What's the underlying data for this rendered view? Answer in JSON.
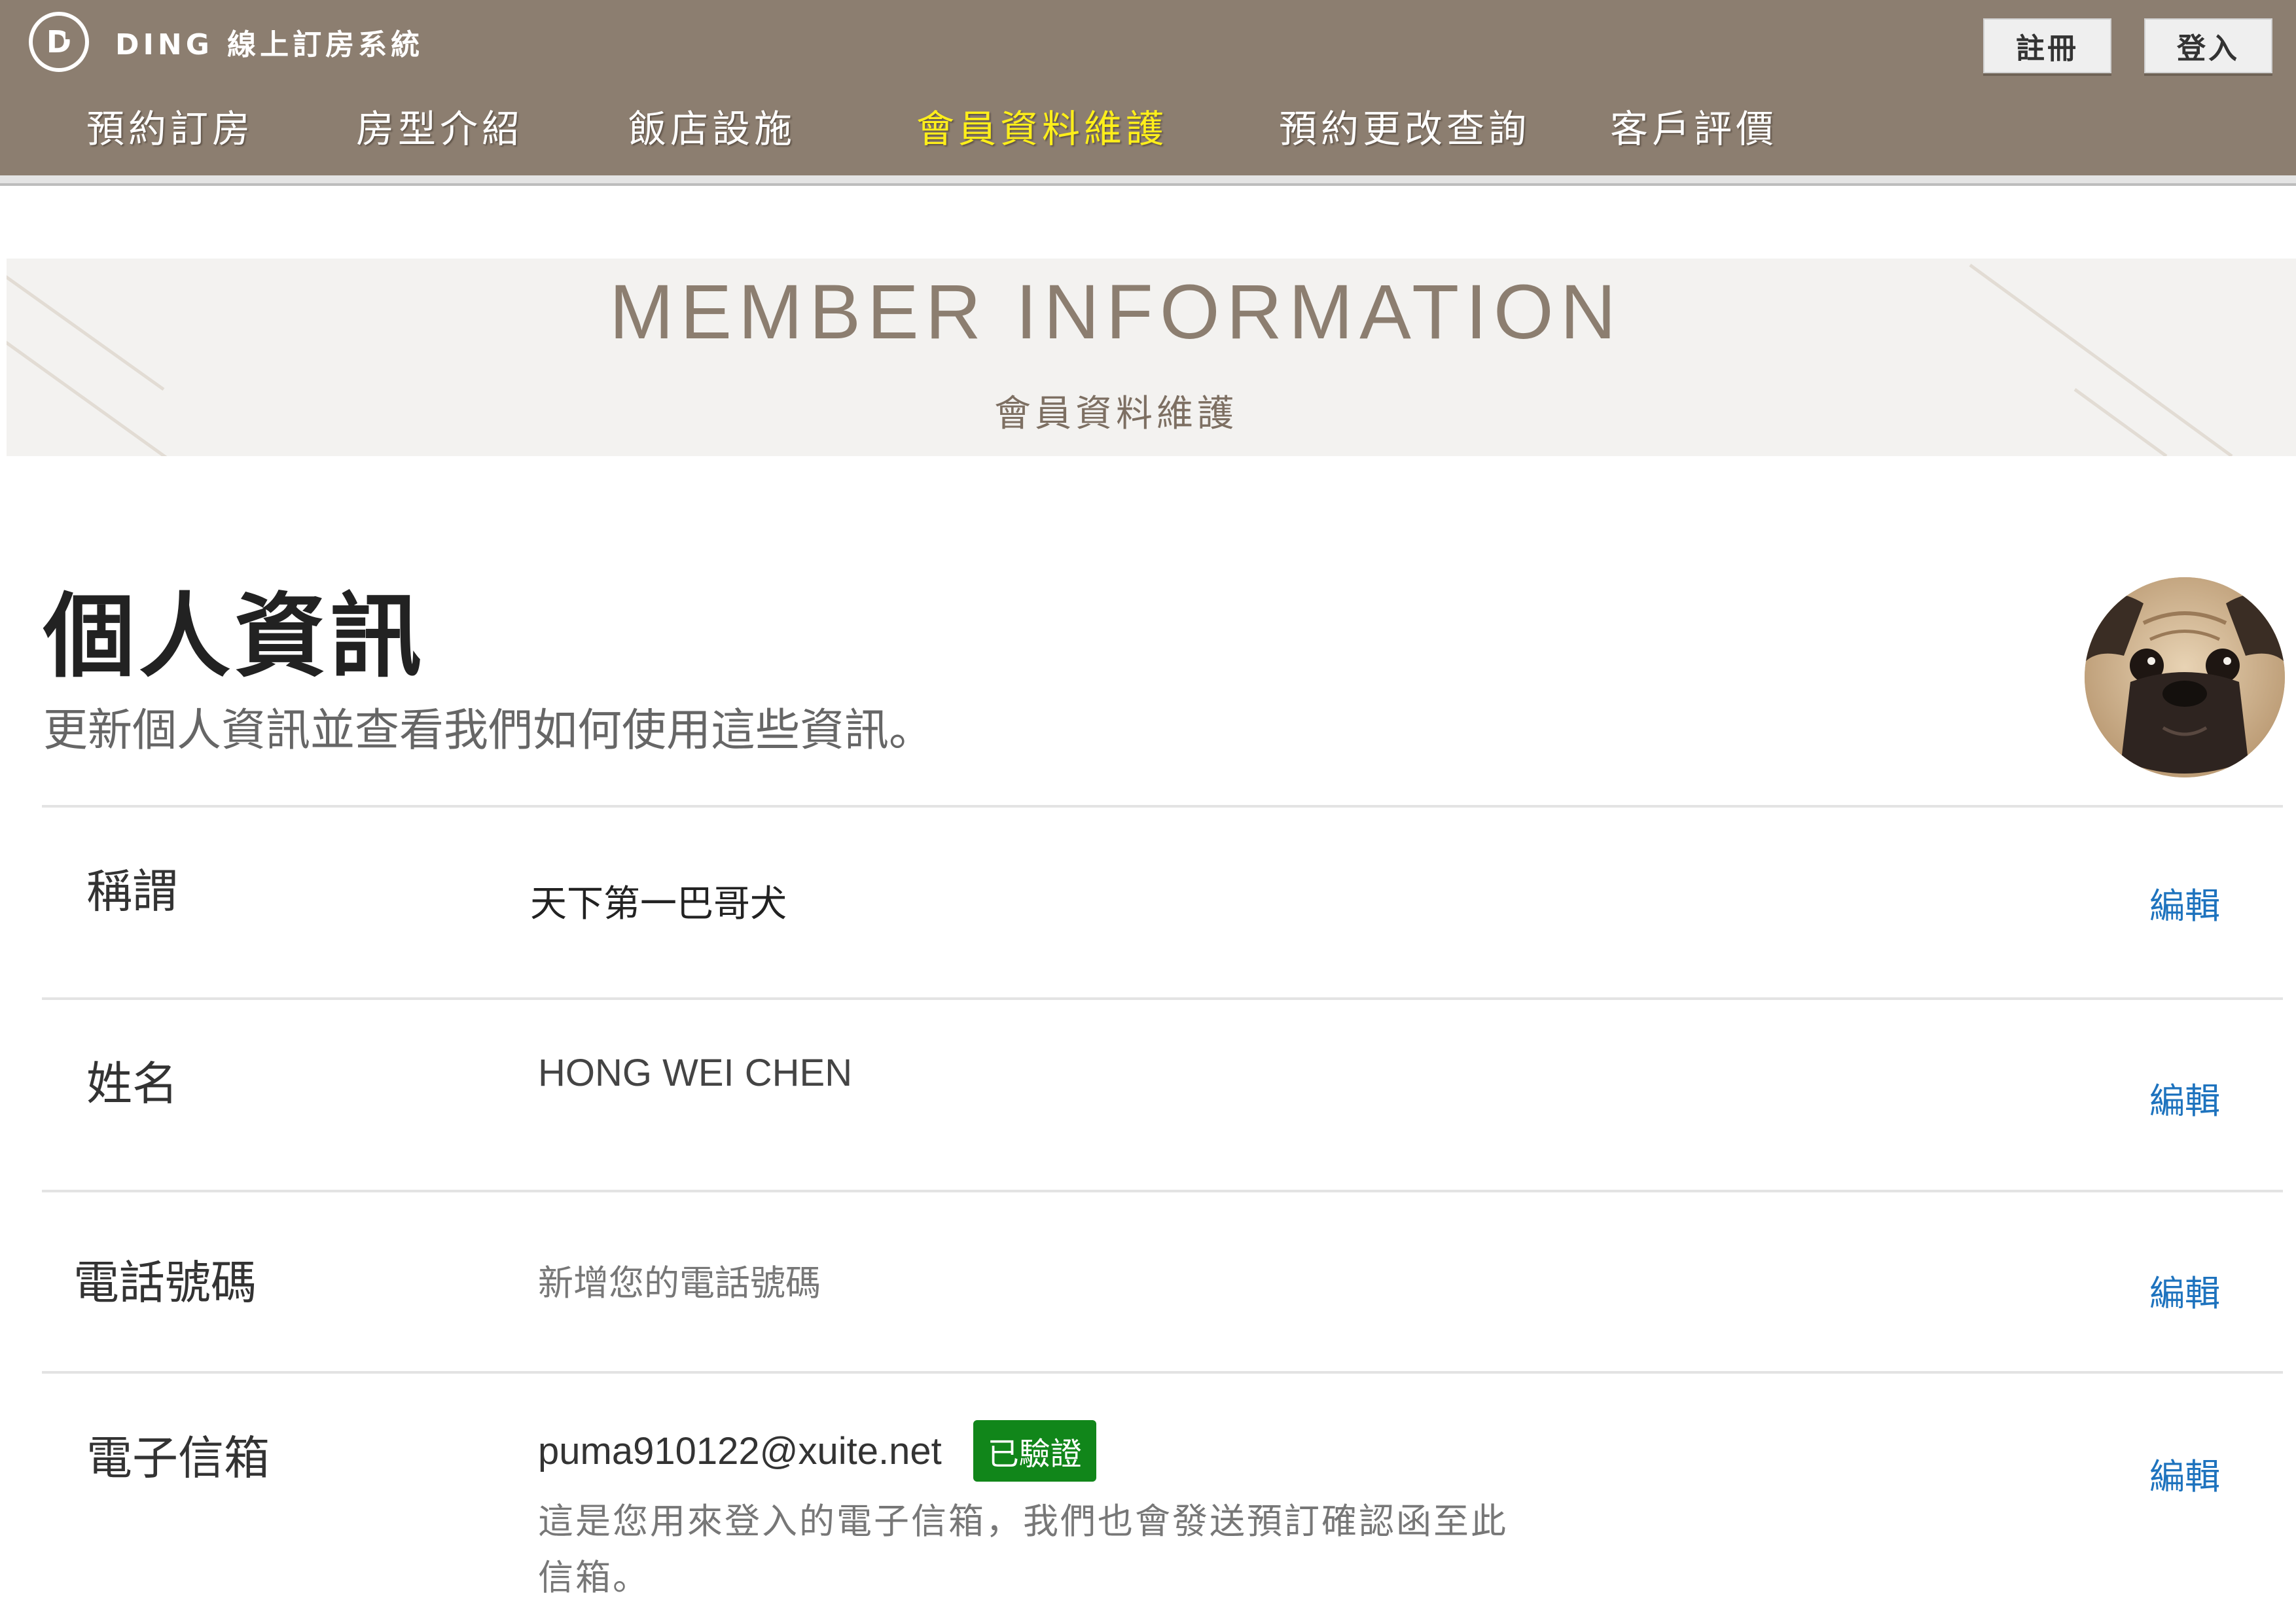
{
  "header": {
    "logo_letter": "D",
    "brand": "DING 線上訂房系統",
    "register_label": "註冊",
    "login_label": "登入",
    "nav": [
      {
        "label": "預約訂房"
      },
      {
        "label": "房型介紹"
      },
      {
        "label": "飯店設施"
      },
      {
        "label": "會員資料維護",
        "active": true
      },
      {
        "label": "預約更改查詢"
      },
      {
        "label": "客戶評價"
      }
    ]
  },
  "banner": {
    "title": "MEMBER INFORMATION",
    "subtitle": "會員資料維護"
  },
  "profile": {
    "title": "個人資訊",
    "description": "更新個人資訊並查看我們如何使用這些資訊。",
    "avatar": "pug-avatar"
  },
  "fields": {
    "nickname": {
      "label": "稱謂",
      "value": "天下第一巴哥犬",
      "edit": "編輯"
    },
    "name": {
      "label": "姓名",
      "value": "HONG WEI CHEN",
      "edit": "編輯"
    },
    "phone": {
      "label": "電話號碼",
      "placeholder": "新增您的電話號碼",
      "edit": "編輯"
    },
    "email": {
      "label": "電子信箱",
      "value": "puma910122@xuite.net",
      "badge": "已驗證",
      "note": "這是您用來登入的電子信箱，我們也會發送預訂確認函至此信箱。",
      "edit": "編輯"
    }
  },
  "colors": {
    "header_bg": "#8c7e70",
    "nav_active": "#ffef1a",
    "link": "#1e73be",
    "verified": "#11861a"
  }
}
